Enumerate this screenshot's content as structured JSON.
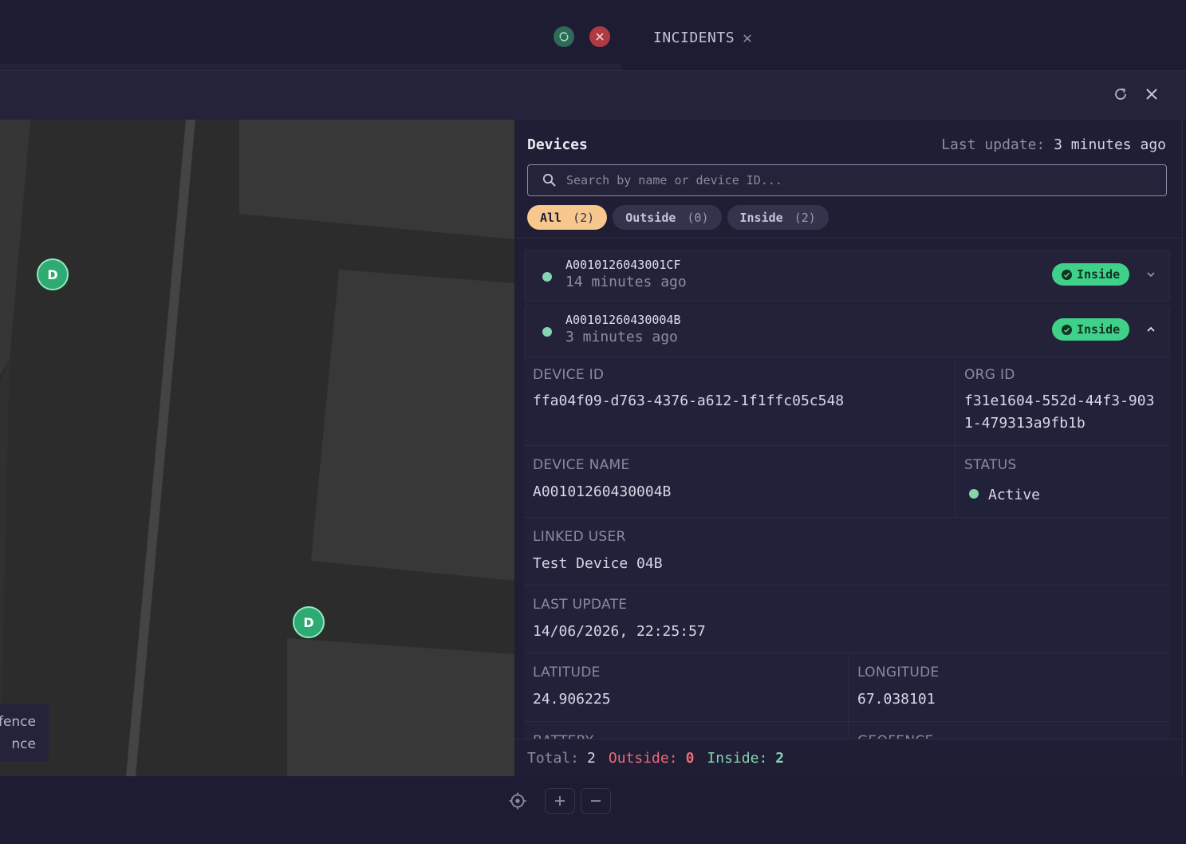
{
  "topbar": {
    "tab_label": "INCIDENTS",
    "tab_close": "✕"
  },
  "map": {
    "markers": [
      {
        "label": "D"
      },
      {
        "label": "D"
      }
    ],
    "legend": [
      "fence",
      "nce"
    ]
  },
  "panel": {
    "title": "Devices",
    "last_update_label": "Last update:",
    "last_update_value": "3 minutes ago",
    "search_placeholder": "Search by name or device ID...",
    "filters": [
      {
        "label": "All",
        "count": "(2)",
        "active": true
      },
      {
        "label": "Outside",
        "count": "(0)",
        "active": false
      },
      {
        "label": "Inside",
        "count": "(2)",
        "active": false
      }
    ],
    "devices": [
      {
        "name": "A0010126043001CF",
        "time": "14 minutes ago",
        "badge": "Inside",
        "expanded": false
      },
      {
        "name": "A00101260430004B",
        "time": "3 minutes ago",
        "badge": "Inside",
        "expanded": true
      }
    ],
    "details": {
      "device_id_label": "DEVICE ID",
      "device_id_value": "ffa04f09-d763-4376-a612-1f1ffc05c548",
      "org_id_label": "ORG ID",
      "org_id_line1": "f31e1604-552d-44f3-903",
      "org_id_line2": "1-479313a9fb1b",
      "device_name_label": "DEVICE NAME",
      "device_name_value": "A00101260430004B",
      "status_label": "STATUS",
      "status_value": "Active",
      "linked_user_label": "LINKED USER",
      "linked_user_value": "Test Device 04B",
      "last_update_label": "LAST UPDATE",
      "last_update_value": "14/06/2026, 22:25:57",
      "latitude_label": "LATITUDE",
      "latitude_value": "24.906225",
      "longitude_label": "LONGITUDE",
      "longitude_value": "67.038101",
      "battery_label": "BATTERY",
      "geofence_label": "GEOFENCE"
    },
    "footer": {
      "total_label": "Total:",
      "total_value": "2",
      "outside_label": "Outside:",
      "outside_value": "0",
      "inside_label": "Inside:",
      "inside_value": "2"
    }
  },
  "colors": {
    "accent": "#f6c88e",
    "inside_badge": "#3fd08a",
    "outside_text": "#ee6b76",
    "status_dot": "#86d4b0"
  }
}
